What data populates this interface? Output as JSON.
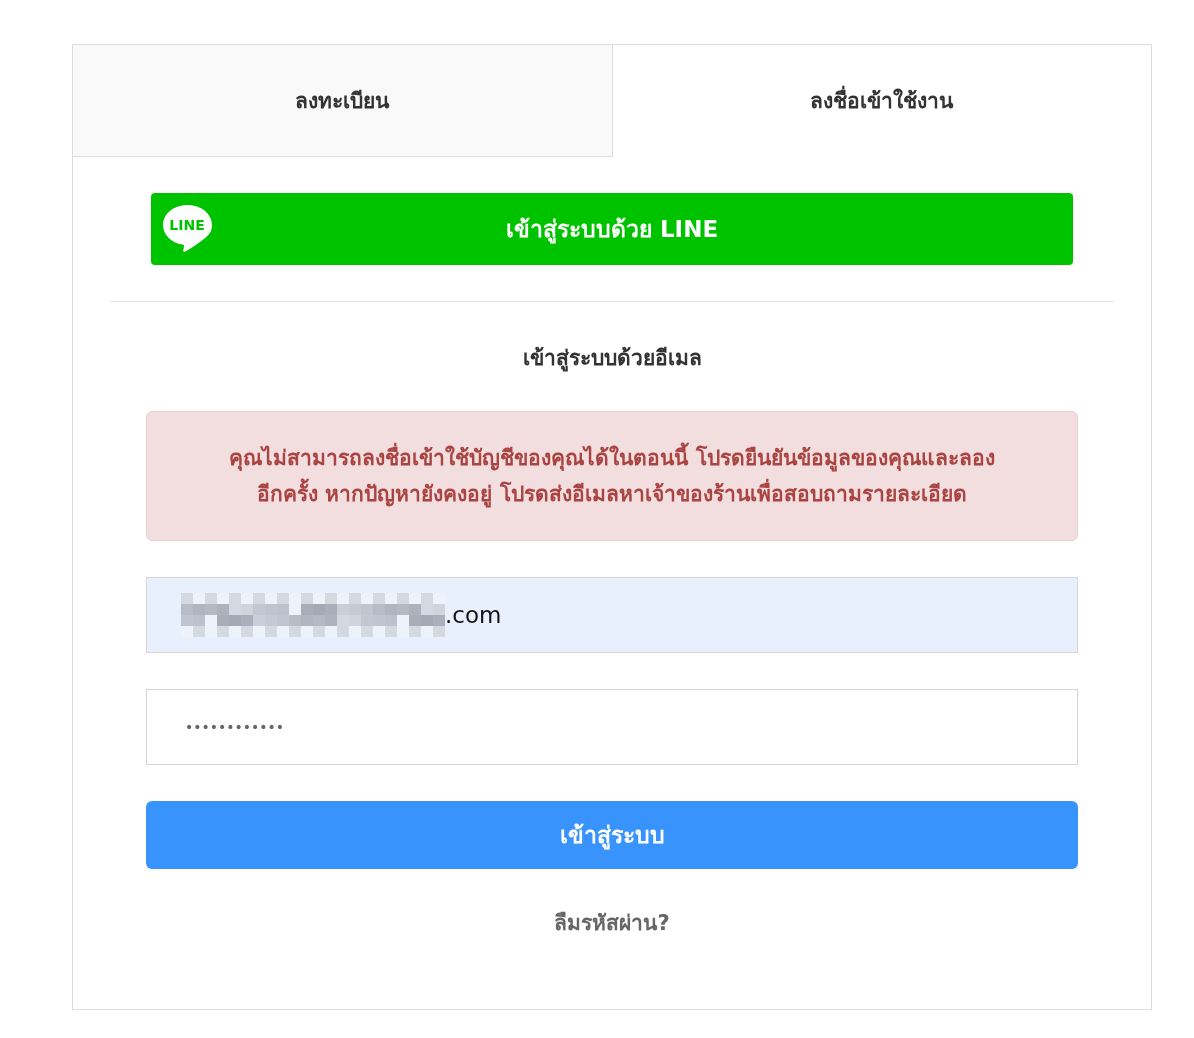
{
  "tabs": [
    {
      "label": "ลงทะเบียน",
      "selected": false
    },
    {
      "label": "ลงชื่อเข้าใช้งาน",
      "selected": true
    }
  ],
  "line_button": {
    "logo_text": "LINE",
    "label": "เข้าสู่ระบบด้วย LINE"
  },
  "email_login": {
    "heading": "เข้าสู่ระบบด้วยอีเมล",
    "alert": {
      "message": "คุณไม่สามารถลงชื่อเข้าใช้บัญชีของคุณได้ในตอนนี้ โปรดยืนยันข้อมูลของคุณและลองอีกครั้ง หากปัญหายังคงอยู่ โปรดส่งอีเมลหาเจ้าของร้านเพื่อสอบถามรายละเอียด"
    },
    "email_field": {
      "value": ".com",
      "autofilled": true,
      "redacted": true
    },
    "password_field": {
      "masked_value": "••••••••••••"
    },
    "submit_button": {
      "label": "เข้าสู่ระบบ"
    },
    "forgot_link": {
      "label": "ลืมรหัสผ่าน?"
    }
  }
}
